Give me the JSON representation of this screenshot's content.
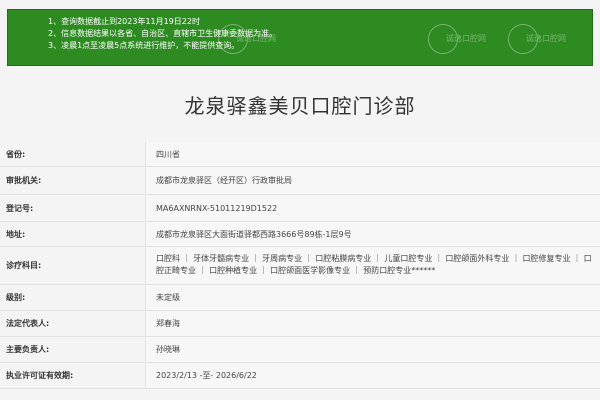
{
  "notice": {
    "lines": [
      "1、查询数据截止到2023年11月19日22时",
      "2、信息数据结果以各省、自治区、直辖市卫生健康委数据为准。",
      "3、凌晨1点至凌晨5点系统进行维护，不能提供查询。"
    ],
    "watermark": "诚逸口腔网"
  },
  "title": "龙泉驿鑫美贝口腔门诊部",
  "fields": [
    {
      "label": "省份:",
      "value": "四川省"
    },
    {
      "label": "审批机关:",
      "value": "成都市龙泉驿区（经开区）行政审批局"
    },
    {
      "label": "登记号:",
      "value": "MA6AXNRNX-51011219D1522"
    },
    {
      "label": "地址:",
      "value": "成都市龙泉驿区大面街道驿都西路3666号89栋-1层9号"
    },
    {
      "label": "诊疗科目:",
      "value": "口腔科 ｜ 牙体牙髓病专业 ｜ 牙周病专业 ｜ 口腔粘膜病专业 ｜ 儿童口腔专业 ｜ 口腔颌面外科专业 ｜ 口腔修复专业 ｜ 口腔正畸专业 ｜ 口腔种植专业 ｜ 口腔颌面医学影像专业 ｜ 预防口腔专业******"
    },
    {
      "label": "级别:",
      "value": "未定级"
    },
    {
      "label": "法定代表人:",
      "value": "郑春海"
    },
    {
      "label": "主要负责人:",
      "value": "孙晓琳"
    },
    {
      "label": "执业许可证有效期:",
      "value": "2023/2/13 -至- 2026/6/22"
    }
  ],
  "colors": {
    "notice_bg": "#2e8b22",
    "page_bg": "#f4f4f4"
  }
}
